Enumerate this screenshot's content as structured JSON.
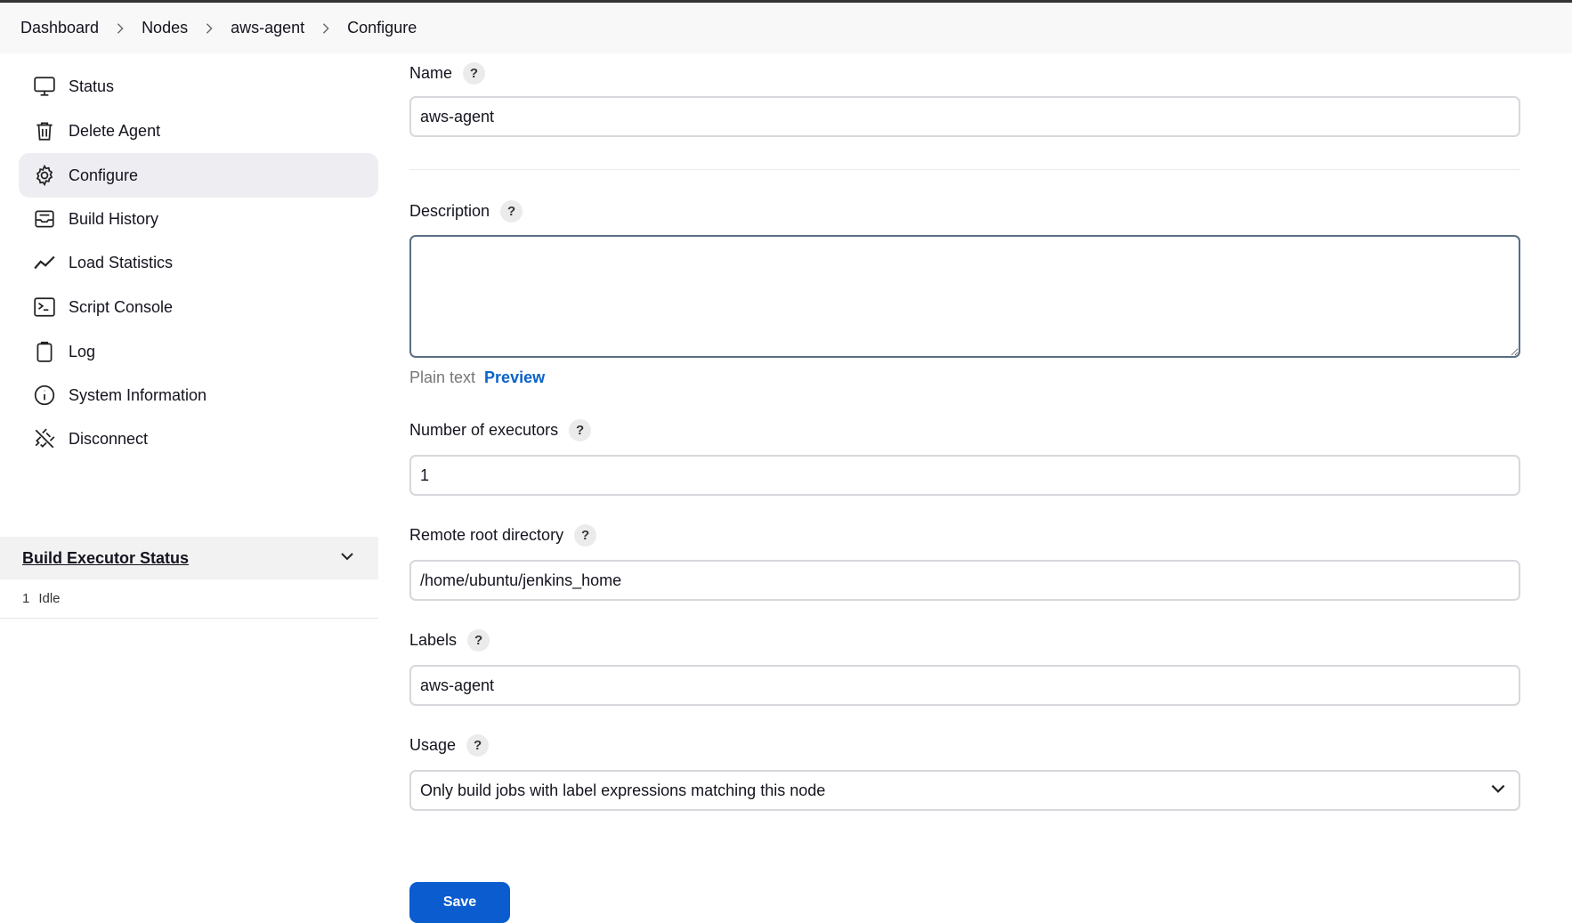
{
  "breadcrumb": [
    "Dashboard",
    "Nodes",
    "aws-agent",
    "Configure"
  ],
  "sidebar": {
    "items": [
      {
        "label": "Status",
        "icon": "monitor-icon"
      },
      {
        "label": "Delete Agent",
        "icon": "trash-icon"
      },
      {
        "label": "Configure",
        "icon": "gear-icon",
        "active": true
      },
      {
        "label": "Build History",
        "icon": "inbox-icon"
      },
      {
        "label": "Load Statistics",
        "icon": "line-chart-icon"
      },
      {
        "label": "Script Console",
        "icon": "terminal-icon"
      },
      {
        "label": "Log",
        "icon": "clipboard-icon"
      },
      {
        "label": "System Information",
        "icon": "info-icon"
      },
      {
        "label": "Disconnect",
        "icon": "unplug-icon"
      }
    ]
  },
  "executor_status": {
    "title": "Build Executor Status",
    "rows": [
      {
        "number": "1",
        "state": "Idle"
      }
    ]
  },
  "form": {
    "name": {
      "label": "Name",
      "help": "?",
      "value": "aws-agent"
    },
    "description": {
      "label": "Description",
      "help": "?",
      "value": "",
      "format_plain": "Plain text",
      "format_preview": "Preview"
    },
    "executors": {
      "label": "Number of executors",
      "help": "?",
      "value": "1"
    },
    "remote_root": {
      "label": "Remote root directory",
      "help": "?",
      "value": "/home/ubuntu/jenkins_home"
    },
    "labels": {
      "label": "Labels",
      "help": "?",
      "value": "aws-agent"
    },
    "usage": {
      "label": "Usage",
      "help": "?",
      "value": "Only build jobs with label expressions matching this node"
    },
    "save_label": "Save"
  },
  "colors": {
    "accent": "#0b5ccf",
    "link": "#0b63c9",
    "active_bg": "#ededf2"
  }
}
